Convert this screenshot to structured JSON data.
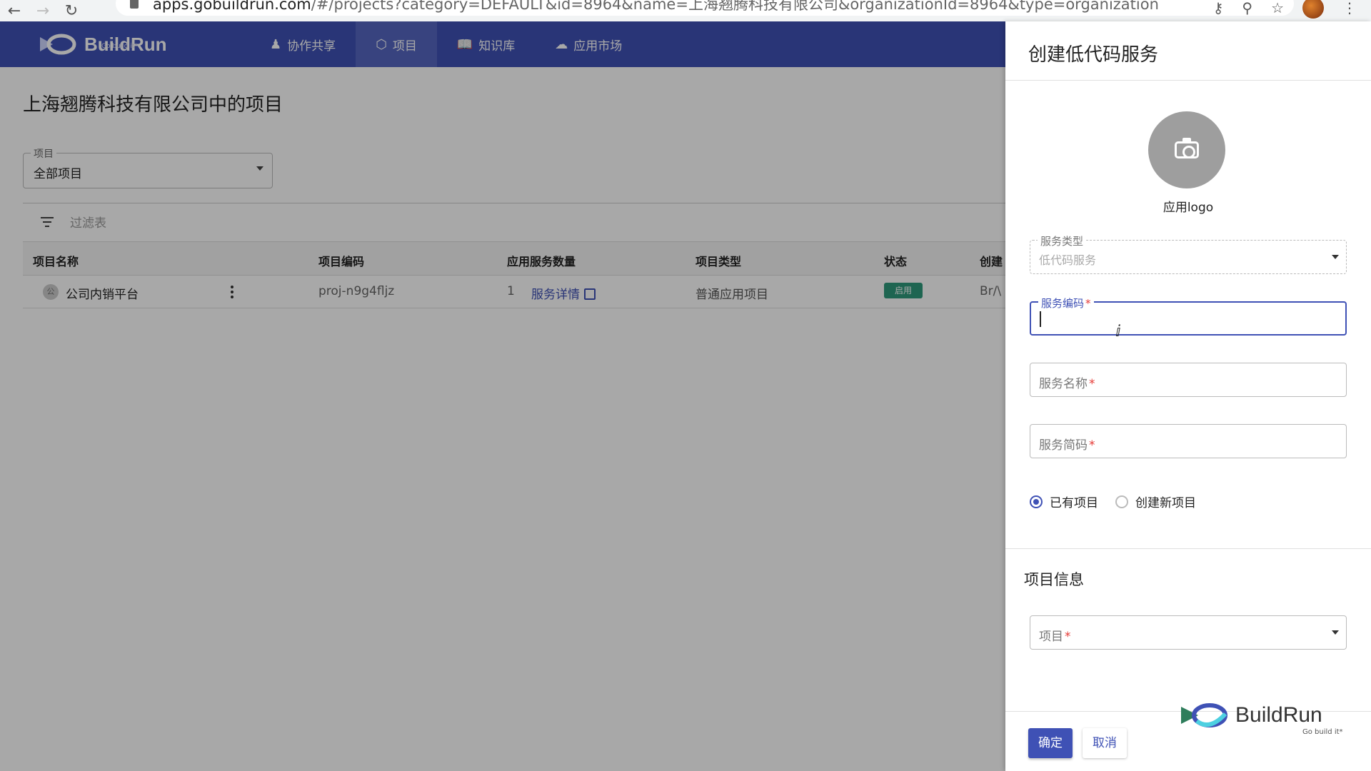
{
  "browser": {
    "url_host": "apps.gobuildrun.com",
    "url_path": "/#/projects?category=DEFAULT&id=8964&name=上海翘腾科技有限公司&organizationId=8964&type=organization"
  },
  "header": {
    "brand": "BuildRun",
    "brand_sub": "Go build it*",
    "nav": [
      {
        "label": "协作共享",
        "icon": "collab-icon"
      },
      {
        "label": "项目",
        "icon": "cube-icon"
      },
      {
        "label": "知识库",
        "icon": "book-icon"
      },
      {
        "label": "应用市场",
        "icon": "cloud-icon"
      }
    ]
  },
  "page": {
    "title": "上海翘腾科技有限公司中的项目",
    "project_select": {
      "label": "项目",
      "value": "全部项目"
    },
    "filter_placeholder": "过滤表"
  },
  "table": {
    "columns": [
      "项目名称",
      "项目编码",
      "应用服务数量",
      "项目类型",
      "状态",
      "创建"
    ],
    "rows": [
      {
        "avatar": "公",
        "name": "公司内销平台",
        "code": "proj-n9g4fljz",
        "service_count": "1",
        "service_link": "服务详情",
        "type": "普通应用项目",
        "status": "启用",
        "creator": "Br/\\"
      }
    ]
  },
  "drawer": {
    "title": "创建低代码服务",
    "logo_label": "应用logo",
    "service_type": {
      "label": "服务类型",
      "value": "低代码服务"
    },
    "service_code": {
      "label": "服务编码",
      "required": "*",
      "value": ""
    },
    "service_name": {
      "label": "服务名称",
      "required": "*"
    },
    "service_short": {
      "label": "服务简码",
      "required": "*"
    },
    "radio_existing": "已有项目",
    "radio_new": "创建新项目",
    "section_title": "项目信息",
    "project_field": {
      "label": "项目",
      "required": "*"
    },
    "confirm": "确定",
    "cancel": "取消"
  },
  "watermark": {
    "brand": "BuildRun",
    "sub": "Go build it*"
  },
  "colors": {
    "primary": "#3f51b5",
    "status_green": "#2e9a7c",
    "required": "#e53935"
  }
}
